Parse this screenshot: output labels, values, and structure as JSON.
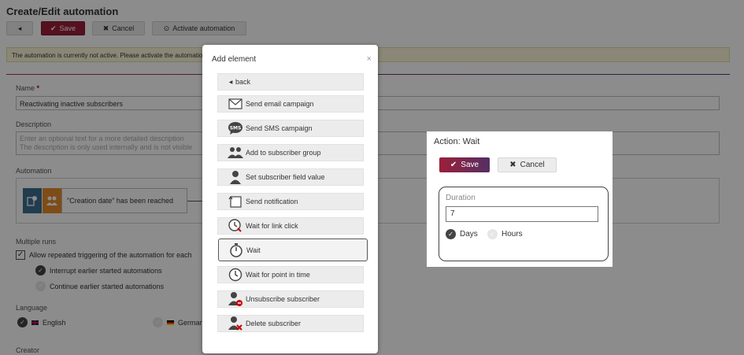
{
  "page": {
    "title": "Create/Edit automation",
    "toolbar": {
      "back_label": "◂",
      "save_label": "Save",
      "cancel_label": "Cancel",
      "activate_label": "Activate automation"
    },
    "notice": "The automation is currently not active. Please activate the automation",
    "name": {
      "label": "Name",
      "required_mark": "*",
      "value": "Reactivating inactive subscribers"
    },
    "description": {
      "label": "Description",
      "placeholder_line1": "Enter an optional text for a more detailed description",
      "placeholder_line2": "The description is only used internally and is not visible"
    },
    "automation": {
      "label": "Automation",
      "condition": "\"Creation date\" has been reached"
    },
    "multiple_runs": {
      "label": "Multiple runs",
      "allow_label": "Allow repeated triggering of the automation for each",
      "interrupt_label": "Interrupt earlier started automations",
      "continue_label": "Continue earlier started automations"
    },
    "language": {
      "label": "Language",
      "english": "English",
      "german": "German"
    },
    "creator_label": "Creator"
  },
  "add_element": {
    "title": "Add element",
    "close": "×",
    "items": [
      {
        "label": "back",
        "icon": "back-icon"
      },
      {
        "label": "Send email campaign",
        "icon": "email-icon"
      },
      {
        "label": "Send SMS campaign",
        "icon": "sms-icon"
      },
      {
        "label": "Add to subscriber group",
        "icon": "group-icon"
      },
      {
        "label": "Set subscriber field value",
        "icon": "user-icon"
      },
      {
        "label": "Send notification",
        "icon": "notification-icon"
      },
      {
        "label": "Wait for link click",
        "icon": "link-click-clock-icon"
      },
      {
        "label": "Wait",
        "icon": "stopwatch-icon"
      },
      {
        "label": "Wait for point in time",
        "icon": "clock-icon"
      },
      {
        "label": "Unsubscribe subscriber",
        "icon": "user-unsubscribe-icon"
      },
      {
        "label": "Delete subscriber",
        "icon": "user-delete-icon"
      }
    ]
  },
  "wait_action": {
    "title": "Action: Wait",
    "save_label": "Save",
    "cancel_label": "Cancel",
    "duration_label": "Duration",
    "duration_value": "7",
    "days_label": "Days",
    "hours_label": "Hours",
    "selected_unit": "Days"
  },
  "colors": {
    "primary": "#9c1f3a",
    "gradient_end": "#542f63",
    "info_blue": "#3c6e8e",
    "info_orange": "#e58a2b"
  }
}
